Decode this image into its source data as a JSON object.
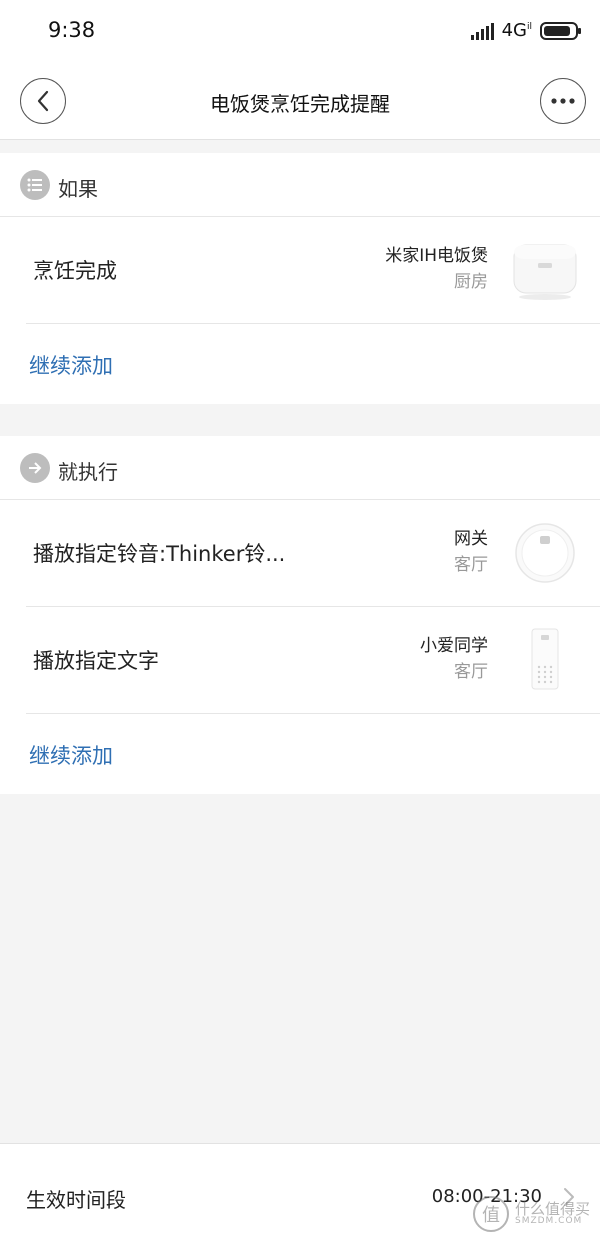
{
  "status_bar": {
    "time": "9:38",
    "network": "4G",
    "network_sup": "il",
    "battery_level": 0.85
  },
  "nav": {
    "title": "电饭煲烹饪完成提醒"
  },
  "if_section": {
    "label": "如果",
    "icon": "list-icon",
    "condition": {
      "title": "烹饪完成",
      "device_name": "米家IH电饭煲",
      "device_room": "厨房",
      "device_icon": "rice-cooker-icon"
    },
    "add_label": "继续添加"
  },
  "then_section": {
    "label": "就执行",
    "icon": "arrow-right-icon",
    "actions": [
      {
        "title": "播放指定铃音:Thinker铃...",
        "device_name": "网关",
        "device_room": "客厅",
        "device_icon": "gateway-icon"
      },
      {
        "title": "播放指定文字",
        "device_name": "小爱同学",
        "device_room": "客厅",
        "device_icon": "smart-speaker-icon"
      }
    ],
    "add_label": "继续添加"
  },
  "effective_time": {
    "label": "生效时间段",
    "value": "08:00-21:30"
  },
  "watermark": {
    "text": "什么值得买",
    "sub": "SMZDM.COM",
    "glyph": "值"
  },
  "colors": {
    "link": "#2f6fb3",
    "background": "#f4f4f4",
    "icon_gray": "#bdbdbd"
  }
}
